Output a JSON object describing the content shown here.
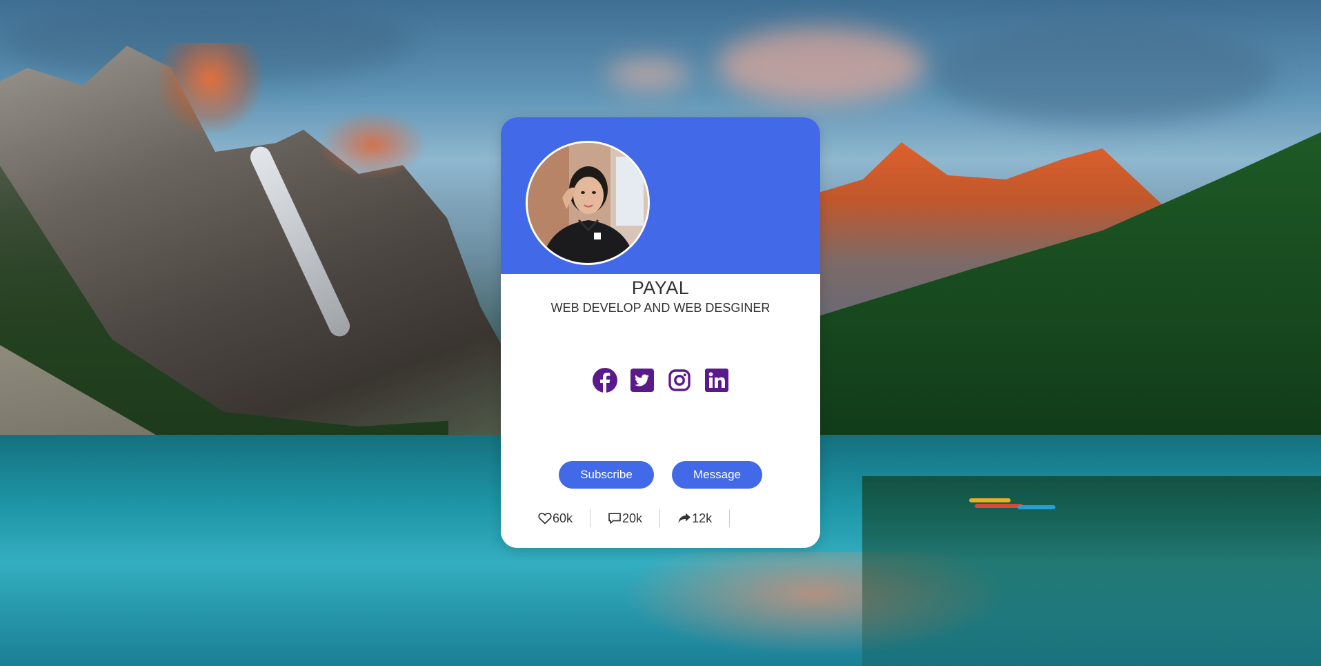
{
  "profile": {
    "name": "PAYAL",
    "role": "WEB DEVELOP AND WEB DESGINER"
  },
  "socials": [
    {
      "icon": "facebook-icon"
    },
    {
      "icon": "twitter-icon"
    },
    {
      "icon": "instagram-icon"
    },
    {
      "icon": "linkedin-icon"
    }
  ],
  "buttons": {
    "subscribe_label": "Subscribe",
    "message_label": "Message"
  },
  "stats": {
    "likes": "60k",
    "comments": "20k",
    "shares": "12k"
  },
  "colors": {
    "accent": "#4169e8",
    "icon": "#5a1a8c",
    "text": "#333333",
    "card": "#ffffff"
  }
}
